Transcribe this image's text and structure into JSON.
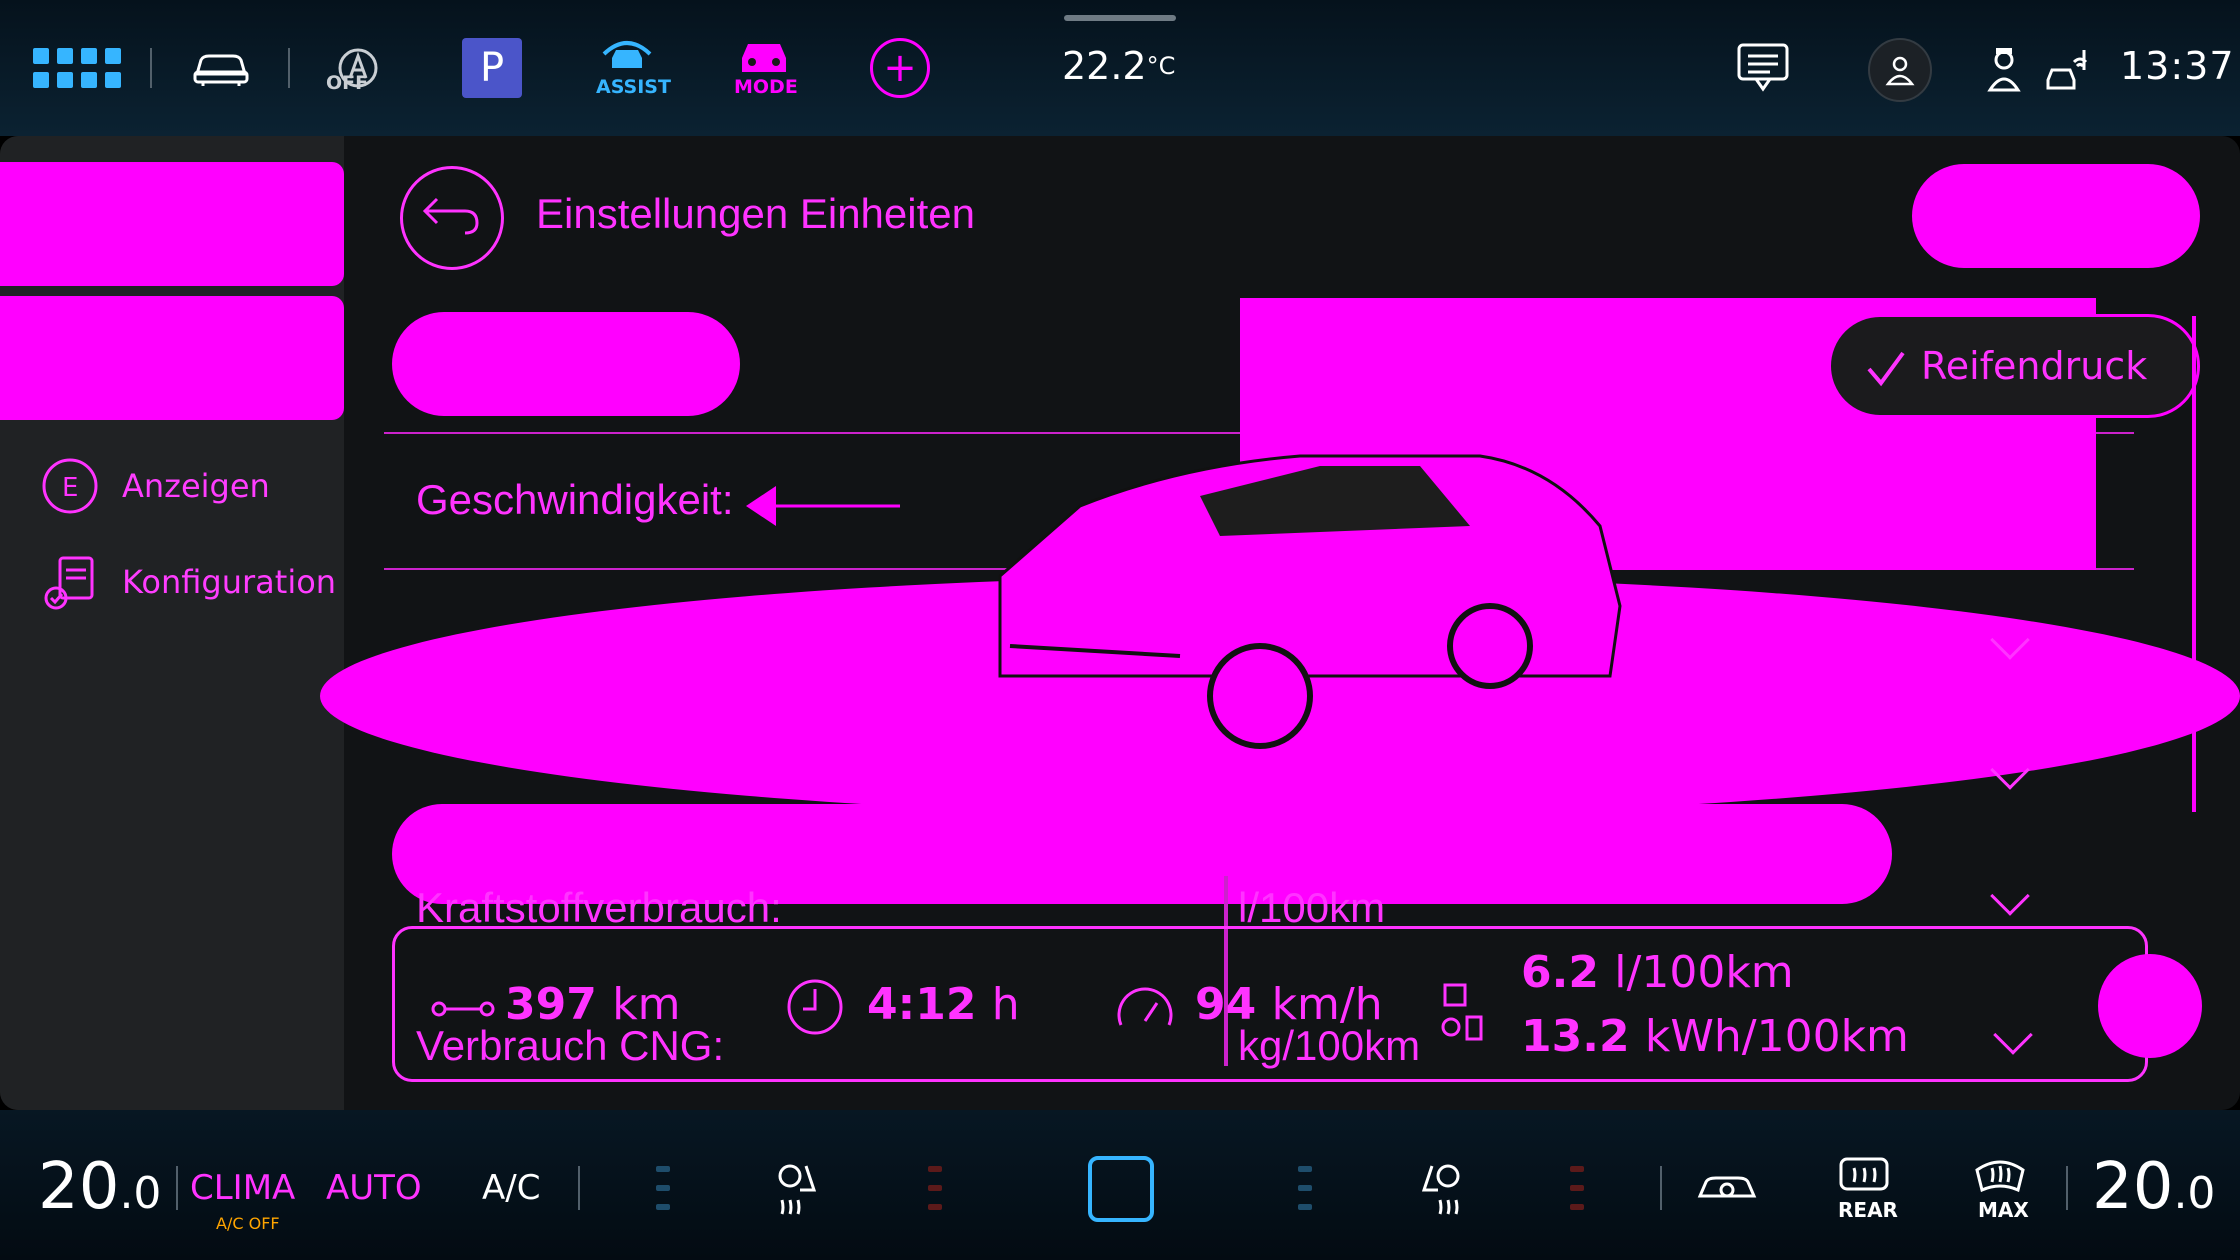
{
  "topbar": {
    "acc_status": "OFF",
    "parking_label": "P",
    "assist_label": "ASSIST",
    "mode_label": "MODE",
    "temperature": "22.2",
    "temperature_unit": "°C",
    "clock": "13:37"
  },
  "sidebar": {
    "items": [
      {
        "label": "Anzeigen",
        "icon": "fuel-economy-icon"
      },
      {
        "label": "Konfiguration",
        "icon": "clipboard-check-icon"
      }
    ]
  },
  "header": {
    "title": "Einstellungen Einheiten"
  },
  "settings": {
    "option_chip": "Reifendruck",
    "rows": [
      {
        "label": "Geschwindigkeit:",
        "value": ""
      },
      {
        "label": "Kraftstoffverbrauch:",
        "value": "l/100km"
      },
      {
        "label": "Verbrauch CNG:",
        "value": "kg/100km"
      }
    ]
  },
  "trip": {
    "range_value": "397",
    "range_unit": "km",
    "time_value": "4:12",
    "time_unit": "h",
    "speed_value": "94",
    "speed_unit": "km/h",
    "fuel_value": "6.2",
    "fuel_unit": "l/100km",
    "electric_value": "13.2",
    "electric_unit": "kWh/100km"
  },
  "climate": {
    "left_temp": "20",
    "left_temp_decimal": ".0",
    "clima_label": "CLIMA",
    "ac_off_label": "A/C OFF",
    "auto_label": "AUTO",
    "ac_label": "A/C",
    "rear_label": "REAR",
    "max_label": "MAX",
    "right_temp": "20",
    "right_temp_decimal": ".0"
  },
  "colors": {
    "accent": "#36b5ff",
    "highlight": "#ff00ff",
    "parking_bg": "#4b55c9"
  }
}
